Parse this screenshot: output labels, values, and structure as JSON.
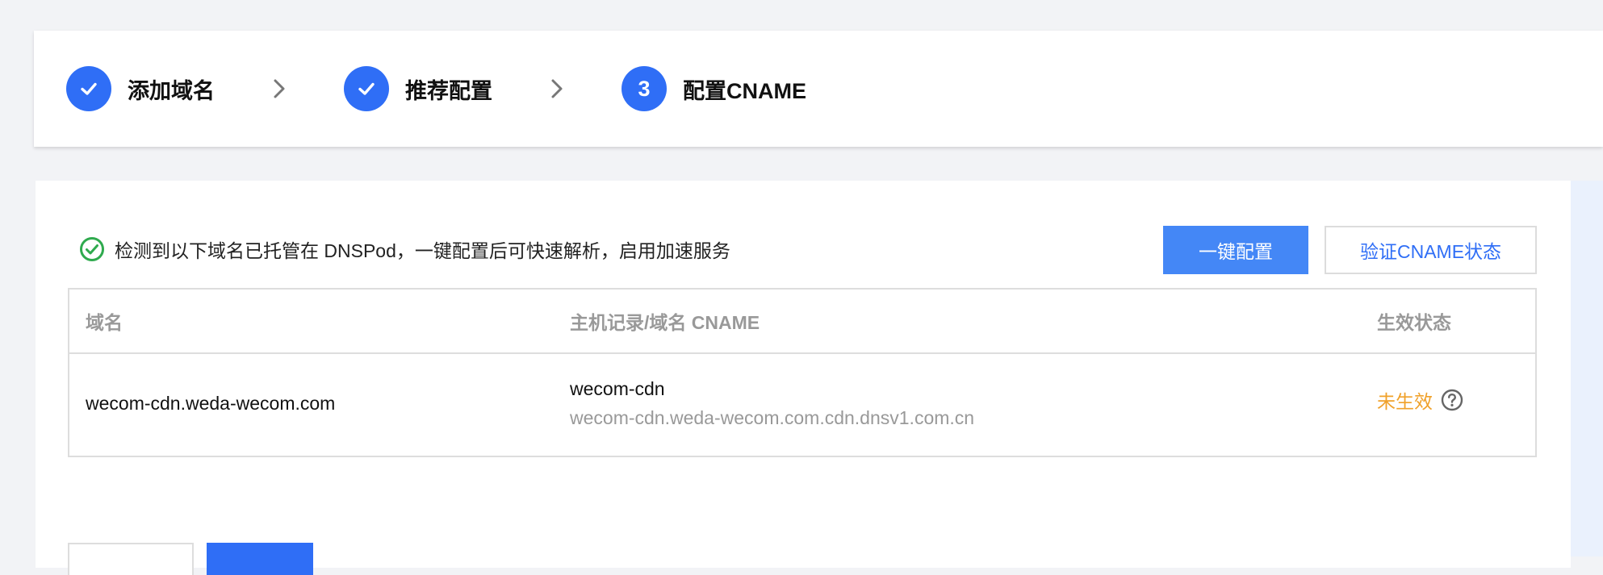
{
  "steps": [
    {
      "label": "添加域名",
      "state": "done",
      "icon": "check-icon"
    },
    {
      "label": "推荐配置",
      "state": "done",
      "icon": "check-icon"
    },
    {
      "label": "配置CNAME",
      "state": "current",
      "number": "3"
    }
  ],
  "notice": {
    "icon": "check-circle-icon",
    "text": "检测到以下域名已托管在 DNSPod，一键配置后可快速解析，启用加速服务"
  },
  "actions": {
    "one_click_label": "一键配置",
    "verify_label": "验证CNAME状态"
  },
  "table": {
    "columns": [
      "域名",
      "主机记录/域名 CNAME",
      "生效状态"
    ],
    "rows": [
      {
        "domain": "wecom-cdn.weda-wecom.com",
        "host_record": "wecom-cdn",
        "cname": "wecom-cdn.weda-wecom.com.cdn.dnsv1.com.cn",
        "status": "未生效"
      }
    ]
  },
  "colors": {
    "accent": "#2f6ef6",
    "primary_button": "#4487f6",
    "success": "#2faa4e",
    "warning": "#f0a12a",
    "muted": "#999999"
  }
}
